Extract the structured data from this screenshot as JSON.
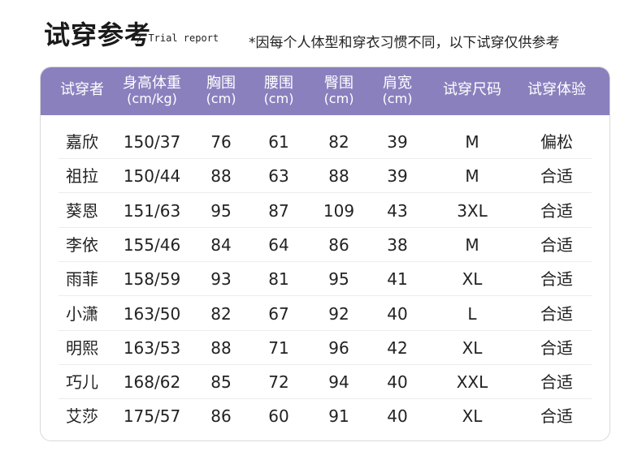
{
  "header": {
    "title": "试穿参考",
    "subtitle": "/ Trial report",
    "note": "*因每个人体型和穿衣习惯不同，以下试穿仅供参考"
  },
  "table": {
    "columns": [
      {
        "label": "试穿者",
        "unit": ""
      },
      {
        "label": "身高体重",
        "unit": "(cm/kg)"
      },
      {
        "label": "胸围",
        "unit": "(cm)"
      },
      {
        "label": "腰围",
        "unit": "(cm)"
      },
      {
        "label": "臀围",
        "unit": "(cm)"
      },
      {
        "label": "肩宽",
        "unit": "(cm)"
      },
      {
        "label": "试穿尺码",
        "unit": ""
      },
      {
        "label": "试穿体验",
        "unit": ""
      }
    ],
    "rows": [
      [
        "嘉欣",
        "150/37",
        "76",
        "61",
        "82",
        "39",
        "M",
        "偏松"
      ],
      [
        "祖拉",
        "150/44",
        "88",
        "63",
        "88",
        "39",
        "M",
        "合适"
      ],
      [
        "葵恩",
        "151/63",
        "95",
        "87",
        "109",
        "43",
        "3XL",
        "合适"
      ],
      [
        "李依",
        "155/46",
        "84",
        "64",
        "86",
        "38",
        "M",
        "合适"
      ],
      [
        "雨菲",
        "158/59",
        "93",
        "81",
        "95",
        "41",
        "XL",
        "合适"
      ],
      [
        "小潇",
        "163/50",
        "82",
        "67",
        "92",
        "40",
        "L",
        "合适"
      ],
      [
        "明熙",
        "163/53",
        "88",
        "71",
        "96",
        "42",
        "XL",
        "合适"
      ],
      [
        "巧儿",
        "168/62",
        "85",
        "72",
        "94",
        "40",
        "XXL",
        "合适"
      ],
      [
        "艾莎",
        "175/57",
        "86",
        "60",
        "91",
        "40",
        "XL",
        "合适"
      ]
    ]
  },
  "colors": {
    "header_bg": "#8b80be",
    "header_text": "#ffffff"
  }
}
